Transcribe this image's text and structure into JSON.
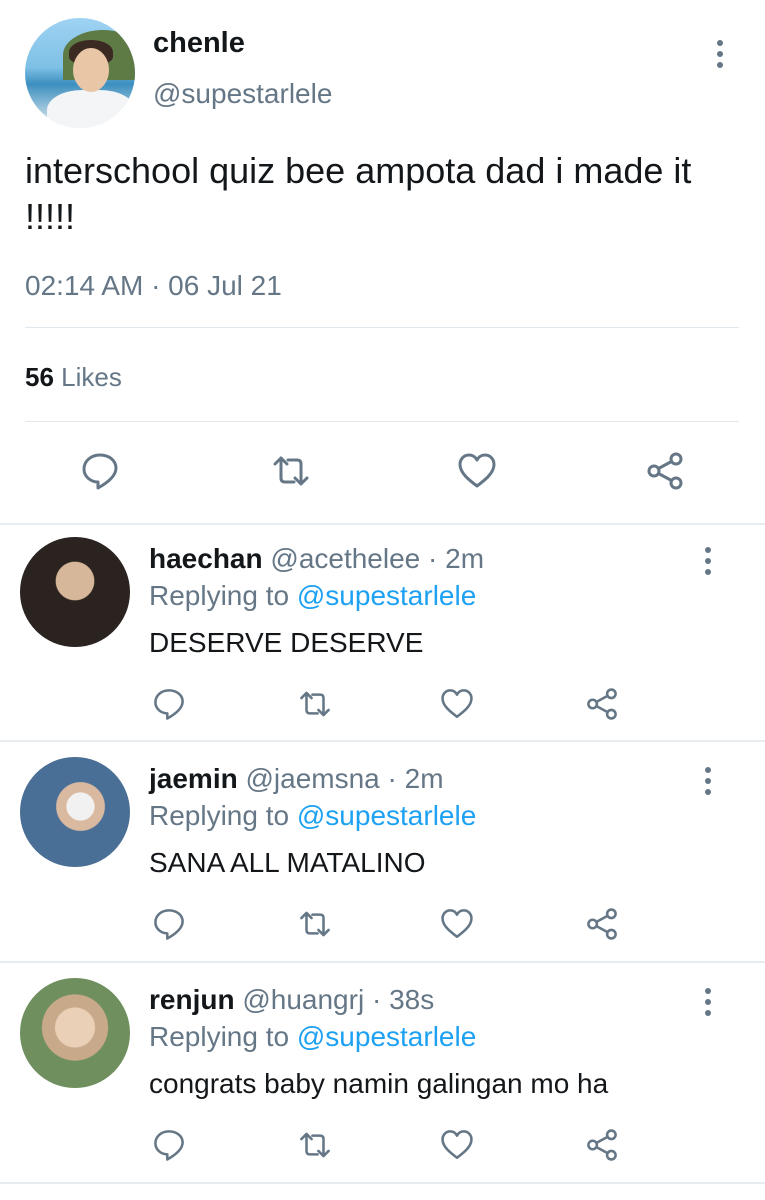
{
  "tweet": {
    "author_name": "chenle",
    "author_handle": "@supestarlele",
    "text": "interschool quiz bee ampota dad i made it !!!!!",
    "timestamp": "02:14 AM · 06 Jul 21",
    "likes_count": "56",
    "likes_label": "Likes",
    "actions": [
      "reply-icon",
      "retweet-icon",
      "like-icon",
      "share-icon"
    ]
  },
  "replies": [
    {
      "name": "haechan",
      "handle": "@acethelee",
      "time": "· 2m",
      "replying_label": "Replying to",
      "replying_to": "@supestarlele",
      "text": "DESERVE DESERVE"
    },
    {
      "name": "jaemin",
      "handle": "@jaemsna",
      "time": "· 2m",
      "replying_label": "Replying to",
      "replying_to": "@supestarlele",
      "text": "SANA ALL MATALINO"
    },
    {
      "name": "renjun",
      "handle": "@huangrj",
      "time": "· 38s",
      "replying_label": "Replying to",
      "replying_to": "@supestarlele",
      "text": "congrats baby namin galingan mo ha"
    }
  ],
  "colors": {
    "text_primary": "#14171a",
    "text_secondary": "#657786",
    "link": "#1da1f2",
    "divider": "#e1e8ed"
  }
}
